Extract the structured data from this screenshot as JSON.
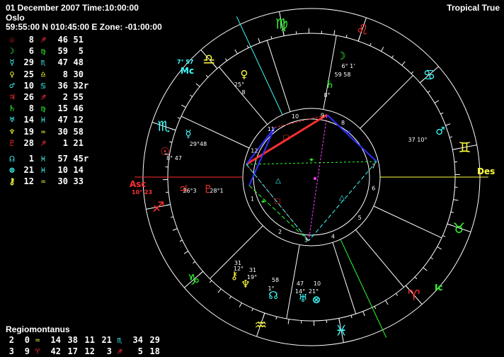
{
  "header": {
    "line1": "01 December 2007 Time:10:00:00",
    "line2": "Oslo",
    "line3": "59:55:00 N 010:45:00 E Zone: -01:00:00",
    "zodiac_mode": "Tropical True"
  },
  "planet_table": [
    {
      "glyph": "☉",
      "glyph_color": "#ff3030",
      "deg": "8",
      "sign": "♐",
      "sign_color": "#ff3030",
      "min": "46",
      "sec": "51",
      "retro": ""
    },
    {
      "glyph": "☽",
      "glyph_color": "#30ff30",
      "deg": "6",
      "sign": "♍",
      "sign_color": "#30ff30",
      "min": "59",
      "sec": "5",
      "retro": ""
    },
    {
      "glyph": "☿",
      "glyph_color": "#40ffff",
      "deg": "29",
      "sign": "♏",
      "sign_color": "#40ffff",
      "min": "47",
      "sec": "48",
      "retro": ""
    },
    {
      "glyph": "♀",
      "glyph_color": "#ffff40",
      "deg": "25",
      "sign": "♎",
      "sign_color": "#ffff40",
      "min": "8",
      "sec": "30",
      "retro": ""
    },
    {
      "glyph": "♂",
      "glyph_color": "#40ffff",
      "deg": "10",
      "sign": "♋",
      "sign_color": "#40ffff",
      "min": "36",
      "sec": "32",
      "retro": "r"
    },
    {
      "glyph": "♃",
      "glyph_color": "#ff3030",
      "deg": "26",
      "sign": "♐",
      "sign_color": "#ff3030",
      "min": "2",
      "sec": "55",
      "retro": ""
    },
    {
      "glyph": "♄",
      "glyph_color": "#30ff30",
      "deg": "8",
      "sign": "♍",
      "sign_color": "#30ff30",
      "min": "15",
      "sec": "46",
      "retro": ""
    },
    {
      "glyph": "♅",
      "glyph_color": "#40ffff",
      "deg": "14",
      "sign": "♓",
      "sign_color": "#40ffff",
      "min": "47",
      "sec": "12",
      "retro": ""
    },
    {
      "glyph": "♆",
      "glyph_color": "#ffff40",
      "deg": "19",
      "sign": "♒",
      "sign_color": "#ffff40",
      "min": "30",
      "sec": "58",
      "retro": ""
    },
    {
      "glyph": "♇",
      "glyph_color": "#ff3030",
      "deg": "28",
      "sign": "♐",
      "sign_color": "#ff3030",
      "min": "1",
      "sec": "21",
      "retro": ""
    },
    {
      "glyph": "☊",
      "glyph_color": "#40ffff",
      "deg": "1",
      "sign": "♓",
      "sign_color": "#40ffff",
      "min": "57",
      "sec": "45",
      "retro": "r"
    },
    {
      "glyph": "⊗",
      "glyph_color": "#40ffff",
      "deg": "21",
      "sign": "♓",
      "sign_color": "#40ffff",
      "min": "10",
      "sec": "14",
      "retro": ""
    },
    {
      "glyph": "⚷",
      "glyph_color": "#ffff40",
      "deg": "12",
      "sign": "♒",
      "sign_color": "#ffff40",
      "min": "30",
      "sec": "33",
      "retro": ""
    }
  ],
  "house_system": {
    "title": "Regiomontanus",
    "row1": {
      "h1": "2",
      "h1m": "0",
      "s1": "♒",
      "s1c": "#ffff40",
      "h2": "14",
      "h2m": "38",
      "h3": "11",
      "h3m": "21",
      "s3": "♏",
      "s3c": "#40ffff",
      "h4": "34",
      "h4m": "29"
    },
    "row2": {
      "h1": "3",
      "h1m": "9",
      "s1": "♈",
      "s1c": "#ff3030",
      "h2": "42",
      "h2m": "17",
      "h3": "12",
      "h3m": "3",
      "s3": "♐",
      "s3c": "#ff3030",
      "h4": "5",
      "h4m": "18"
    }
  },
  "wheel": {
    "axis_labels": {
      "asc": "Asc",
      "asc_deg": "10° 23",
      "des": "Des",
      "mc": "Mc",
      "mc_deg": "7° 57",
      "ic": "Ic"
    },
    "zodiac_signs": [
      {
        "glyph": "♍",
        "color": "#30ff30"
      },
      {
        "glyph": "♌",
        "color": "#ff3030"
      },
      {
        "glyph": "♋",
        "color": "#40ffff"
      },
      {
        "glyph": "♊",
        "color": "#ffff40"
      },
      {
        "glyph": "♉",
        "color": "#30ff30"
      },
      {
        "glyph": "♈",
        "color": "#ff3030"
      },
      {
        "glyph": "♓",
        "color": "#40ffff"
      },
      {
        "glyph": "♒",
        "color": "#ffff40"
      },
      {
        "glyph": "♑",
        "color": "#30ff30"
      },
      {
        "glyph": "♐",
        "color": "#ff3030"
      },
      {
        "glyph": "♏",
        "color": "#40ffff"
      },
      {
        "glyph": "♎",
        "color": "#ffff40"
      }
    ],
    "house_numbers": [
      "1",
      "2",
      "3",
      "4",
      "5",
      "6",
      "7",
      "8",
      "9",
      "10",
      "11",
      "12"
    ],
    "planets": [
      {
        "glyph": "☽",
        "color": "#30ff30",
        "label": "6° 1'",
        "sub": "59 58"
      },
      {
        "glyph": "♄",
        "color": "#30ff30",
        "label": "8°",
        "sub": "16"
      },
      {
        "glyph": "♀",
        "color": "#ffff40",
        "label": "25°",
        "sub": "8"
      },
      {
        "glyph": "♂",
        "color": "#40ffff",
        "label": "37 10°",
        "sub": ""
      },
      {
        "glyph": "☿",
        "color": "#40ffff",
        "label": "29°48",
        "sub": ""
      },
      {
        "glyph": "☉",
        "color": "#ff3030",
        "label": "8° 47",
        "sub": ""
      },
      {
        "glyph": "♃",
        "color": "#ff3030",
        "label": "26°3",
        "sub": ""
      },
      {
        "glyph": "♇",
        "color": "#ff3030",
        "label": "28°1",
        "sub": ""
      },
      {
        "glyph": "⚷",
        "color": "#ffff40",
        "label": "12°",
        "sub": "31"
      },
      {
        "glyph": "♆",
        "color": "#ffff40",
        "label": "19°",
        "sub": "31"
      },
      {
        "glyph": "☊",
        "color": "#40ffff",
        "label": "1°",
        "sub": "58"
      },
      {
        "glyph": "♅",
        "color": "#40ffff",
        "label": "14°",
        "sub": "47"
      },
      {
        "glyph": "⊗",
        "color": "#40ffff",
        "label": "21°",
        "sub": "10"
      }
    ]
  },
  "colors": {
    "red": "#ff3030",
    "green": "#30ff30",
    "cyan": "#40ffff",
    "yellow": "#ffff40",
    "magenta": "#ff40ff",
    "blue": "#3030ff",
    "white": "#ffffff",
    "background": "#000000"
  }
}
